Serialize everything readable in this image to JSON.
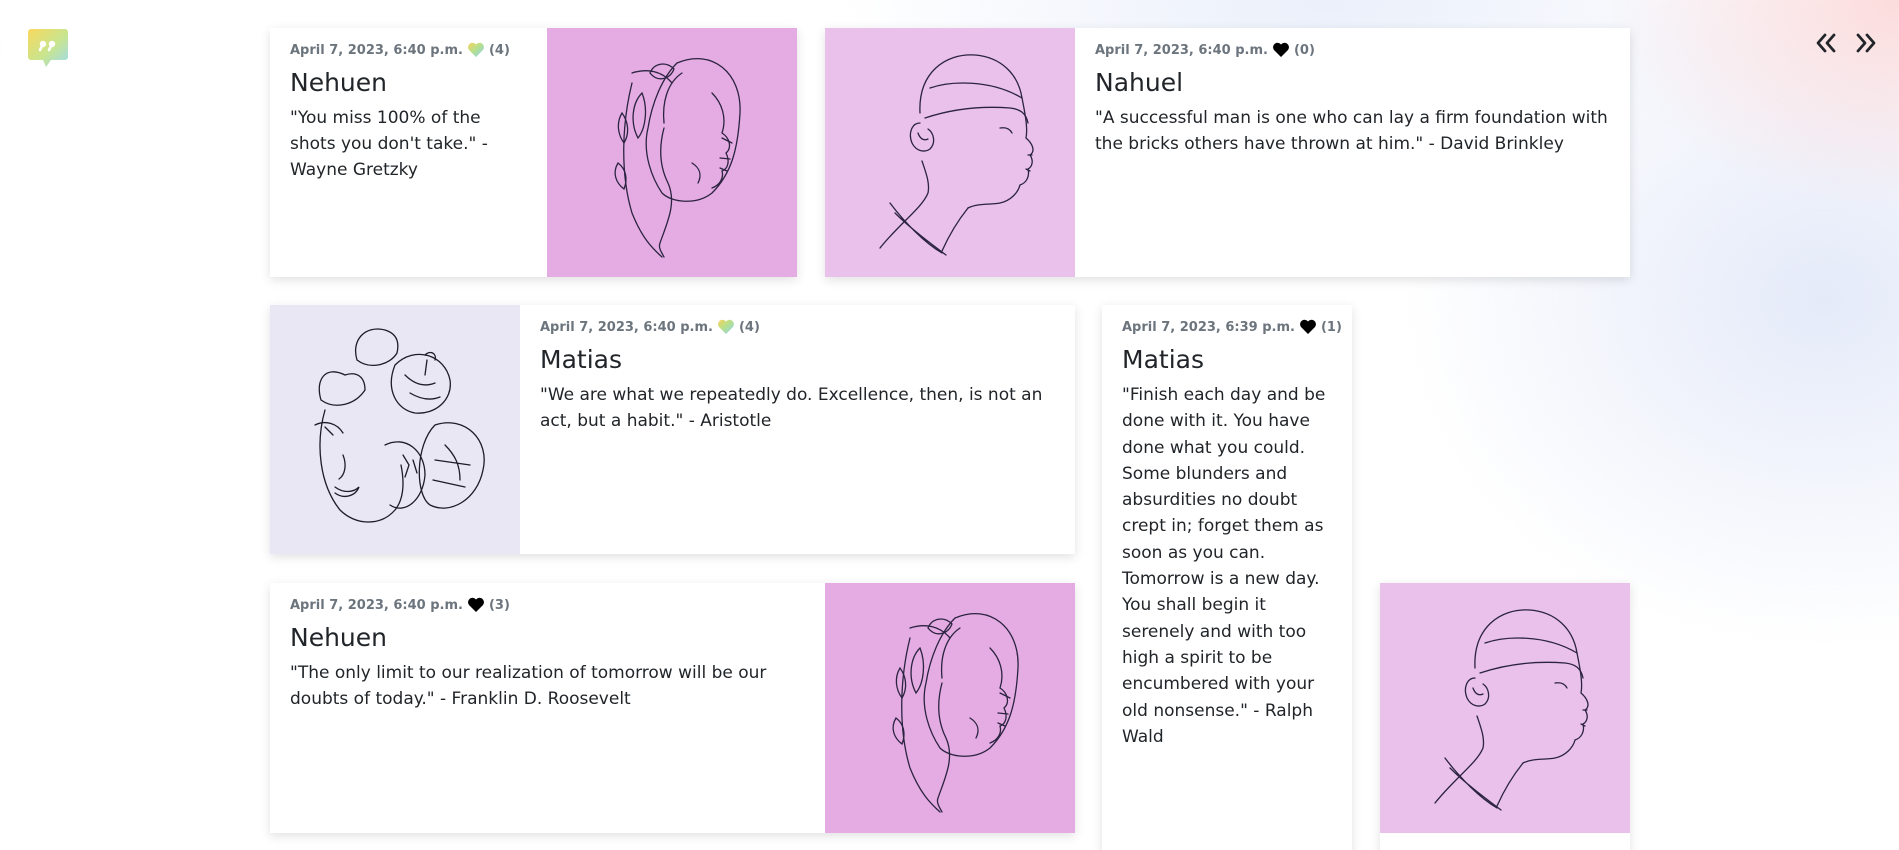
{
  "app": {
    "logo_icon": "quote-bubble-icon",
    "prev_icon": "double-chevron-left-icon",
    "next_icon": "double-chevron-right-icon"
  },
  "colors": {
    "pink_bg": "#e4ace3",
    "light_pink_bg": "#e9c1ea",
    "lavender_bg": "#e9e7f4",
    "heart_filled": "#000000",
    "meta_text": "#6c757d"
  },
  "cards": [
    {
      "date": "April 7, 2023, 6:40 p.m.",
      "likes": "(4)",
      "heart": "rainbow-heart-icon",
      "author": "Nehuen",
      "quote": "\"You miss 100% of the shots you don't take.\" - Wayne Gretzky",
      "art": "woman-leaves-line-art"
    },
    {
      "date": "April 7, 2023, 6:40 p.m.",
      "likes": "(0)",
      "heart": "black-heart-icon",
      "author": "Nahuel",
      "quote": "\"A successful man is one who can lay a firm foundation with the bricks others have thrown at him.\" - David Brinkley",
      "art": "man-profile-line-art"
    },
    {
      "date": "April 7, 2023, 6:40 p.m.",
      "likes": "(4)",
      "heart": "rainbow-heart-icon",
      "author": "Matias",
      "quote": "\"We are what we repeatedly do. Excellence, then, is not an act, but a habit.\" - Aristotle",
      "art": "two-faces-leaves-line-art"
    },
    {
      "date": "April 7, 2023, 6:39 p.m.",
      "likes": "(1)",
      "heart": "black-heart-icon",
      "author": "Matias",
      "quote": "\"Finish each day and be done with it. You have done what you could. Some blunders and absurdities no doubt crept in; forget them as soon as you can. Tomorrow is a new day. You shall begin it serenely and with too high a spirit to be encumbered with your old nonsense.\" - Ralph Wald",
      "art": ""
    },
    {
      "date": "April 7, 2023, 6:40 p.m.",
      "likes": "(3)",
      "heart": "black-heart-icon",
      "author": "Nehuen",
      "quote": "\"The only limit to our realization of tomorrow will be our doubts of today.\" - Franklin D. Roosevelt",
      "art": "woman-leaves-line-art"
    },
    {
      "date": "",
      "likes": "",
      "heart": "",
      "author": "",
      "quote": "",
      "art": "man-profile-line-art"
    }
  ]
}
